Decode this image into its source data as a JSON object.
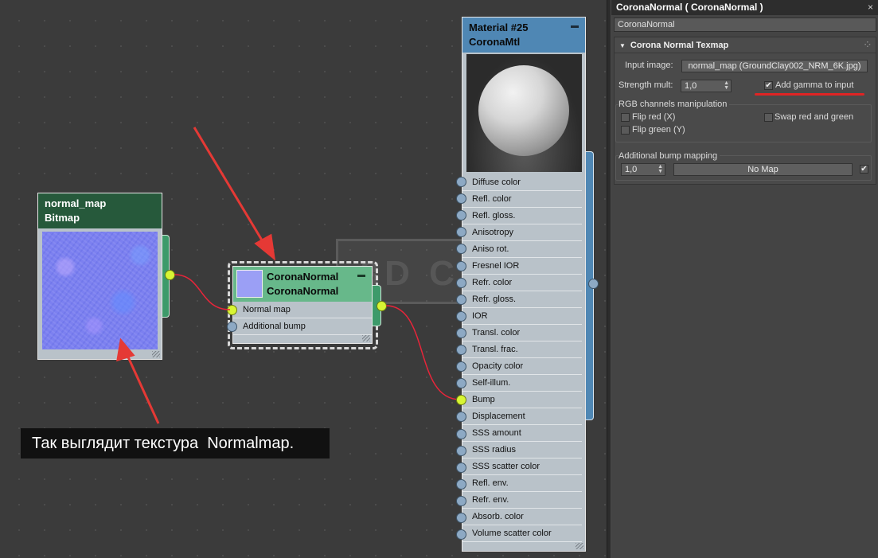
{
  "node_editor": {
    "bitmap_node": {
      "name": "normal_map",
      "type": "Bitmap"
    },
    "normal_node": {
      "name": "CoronaNormal",
      "type": "CoronaNormal",
      "collapse_glyph": "▬",
      "slots": [
        "Normal map",
        "Additional bump"
      ]
    },
    "material_node": {
      "name": "Material #25",
      "type": "CoronaMtl",
      "slots": [
        "Diffuse color",
        "Refl. color",
        "Refl. gloss.",
        "Anisotropy",
        "Aniso rot.",
        "Fresnel IOR",
        "Refr. color",
        "Refr. gloss.",
        "IOR",
        "Transl. color",
        "Transl. frac.",
        "Opacity color",
        "Self-illum.",
        "Bump",
        "Displacement",
        "SSS amount",
        "SSS radius",
        "SSS scatter color",
        "Refl. env.",
        "Refr. env.",
        "Absorb. color",
        "Volume scatter color"
      ]
    },
    "watermark": "3D CLUB",
    "annotation": "Так выглядит текстура  Normalmap.",
    "colors": {
      "bitmap_header": "#26593b",
      "normal_header": "#67b88a",
      "material_header": "#4f87b4",
      "active_socket": "#d8f534",
      "wire": "#e8253a",
      "arrow": "#e53935"
    }
  },
  "panel": {
    "title": "CoronaNormal  ( CoronaNormal )",
    "close_icon": "×",
    "name_field": "CoronaNormal",
    "rollout": {
      "title": "Corona Normal Texmap",
      "input_image_label": "Input image:",
      "input_image_value": "normal_map (GroundClay002_NRM_6K.jpg)",
      "strength_label": "Strength mult:",
      "strength_value": "1,0",
      "gamma_label": "Add gamma to input",
      "gamma_checked": true,
      "rgb_group_label": "RGB channels manipulation",
      "flip_red_label": "Flip red (X)",
      "flip_green_label": "Flip green (Y)",
      "swap_label": "Swap red and green",
      "bump_group_label": "Additional bump mapping",
      "bump_value": "1,0",
      "bump_map_button": "No Map",
      "bump_enabled": true
    }
  }
}
